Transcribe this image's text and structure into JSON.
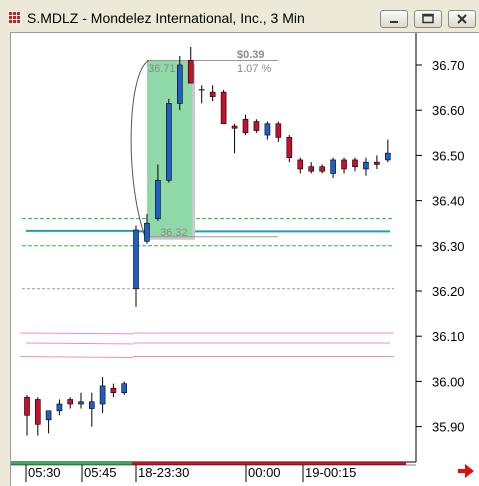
{
  "window": {
    "title": "S.MDLZ - Mondelez International, Inc., 3 Min",
    "icon": "app-chart-icon",
    "controls": [
      "minimize-icon",
      "restore-icon",
      "close-icon"
    ]
  },
  "chart_data": {
    "type": "candlestick",
    "y_ticks": [
      "36.70",
      "36.60",
      "36.50",
      "36.40",
      "36.30",
      "36.20",
      "36.10",
      "36.00",
      "35.90"
    ],
    "y_tick_values": [
      36.7,
      36.6,
      36.5,
      36.4,
      36.3,
      36.2,
      36.1,
      36.0,
      35.9
    ],
    "ylim": [
      35.87,
      36.78
    ],
    "x_labels": [
      "05:30",
      "05:45",
      "18-23:30",
      "00:00",
      "19-00:15"
    ],
    "annotations": {
      "gain_amount": "$0.39",
      "gain_percent": "1.07 %",
      "start_price": "36.32",
      "end_price": "36.71"
    },
    "colors": {
      "up": "#1f5fc4",
      "down": "#c8102e",
      "highlight": "#8fd9a8",
      "pivot_line": "#1aa3b3",
      "green_dash": "#2db34a",
      "pink_line": "#ee8fc8",
      "gray_dash": "#9a9a9a",
      "axis_arrow": "#e01010"
    },
    "reference_lines": {
      "green_dashed": [
        36.36,
        36.3
      ],
      "cyan_solid": [
        36.333,
        36.332
      ],
      "gray_dashed": [
        36.205
      ],
      "pink": [
        36.107,
        36.085,
        36.055
      ]
    },
    "candles_session1": [
      {
        "o": 35.965,
        "h": 35.97,
        "l": 35.88,
        "c": 35.925
      },
      {
        "o": 35.96,
        "h": 35.965,
        "l": 35.88,
        "c": 35.905
      },
      {
        "o": 35.915,
        "h": 35.935,
        "l": 35.885,
        "c": 35.935
      },
      {
        "o": 35.935,
        "h": 35.96,
        "l": 35.925,
        "c": 35.95
      },
      {
        "o": 35.96,
        "h": 35.965,
        "l": 35.94,
        "c": 35.95
      },
      {
        "o": 35.95,
        "h": 35.975,
        "l": 35.94,
        "c": 35.955
      },
      {
        "o": 35.94,
        "h": 35.975,
        "l": 35.9,
        "c": 35.955
      },
      {
        "o": 35.95,
        "h": 36.01,
        "l": 35.93,
        "c": 35.99
      },
      {
        "o": 35.985,
        "h": 35.995,
        "l": 35.965,
        "c": 35.975
      },
      {
        "o": 35.975,
        "h": 36.0,
        "l": 35.97,
        "c": 35.995
      }
    ],
    "candles_session2": [
      {
        "o": 36.205,
        "h": 36.345,
        "l": 36.165,
        "c": 36.335
      },
      {
        "o": 36.31,
        "h": 36.37,
        "l": 36.305,
        "c": 36.35
      },
      {
        "o": 36.36,
        "h": 36.48,
        "l": 36.355,
        "c": 36.445
      },
      {
        "o": 36.445,
        "h": 36.625,
        "l": 36.44,
        "c": 36.615
      },
      {
        "o": 36.615,
        "h": 36.72,
        "l": 36.6,
        "c": 36.7
      },
      {
        "o": 36.71,
        "h": 36.74,
        "l": 36.66,
        "c": 36.66
      },
      {
        "o": 36.645,
        "h": 36.655,
        "l": 36.615,
        "c": 36.645
      },
      {
        "o": 36.64,
        "h": 36.655,
        "l": 36.62,
        "c": 36.63
      },
      {
        "o": 36.64,
        "h": 36.645,
        "l": 36.57,
        "c": 36.57
      },
      {
        "o": 36.565,
        "h": 36.57,
        "l": 36.505,
        "c": 36.56
      },
      {
        "o": 36.58,
        "h": 36.59,
        "l": 36.545,
        "c": 36.55
      },
      {
        "o": 36.575,
        "h": 36.58,
        "l": 36.55,
        "c": 36.555
      },
      {
        "o": 36.545,
        "h": 36.575,
        "l": 36.535,
        "c": 36.57
      },
      {
        "o": 36.57,
        "h": 36.575,
        "l": 36.53,
        "c": 36.54
      },
      {
        "o": 36.54,
        "h": 36.545,
        "l": 36.485,
        "c": 36.495
      },
      {
        "o": 36.49,
        "h": 36.495,
        "l": 36.46,
        "c": 36.47
      },
      {
        "o": 36.475,
        "h": 36.485,
        "l": 36.46,
        "c": 36.465
      },
      {
        "o": 36.475,
        "h": 36.48,
        "l": 36.46,
        "c": 36.465
      },
      {
        "o": 36.46,
        "h": 36.495,
        "l": 36.45,
        "c": 36.49
      },
      {
        "o": 36.49,
        "h": 36.495,
        "l": 36.46,
        "c": 36.47
      },
      {
        "o": 36.49,
        "h": 36.495,
        "l": 36.465,
        "c": 36.475
      },
      {
        "o": 36.47,
        "h": 36.495,
        "l": 36.455,
        "c": 36.485
      },
      {
        "o": 36.485,
        "h": 36.5,
        "l": 36.47,
        "c": 36.48
      },
      {
        "o": 36.49,
        "h": 36.535,
        "l": 36.485,
        "c": 36.505
      }
    ]
  }
}
